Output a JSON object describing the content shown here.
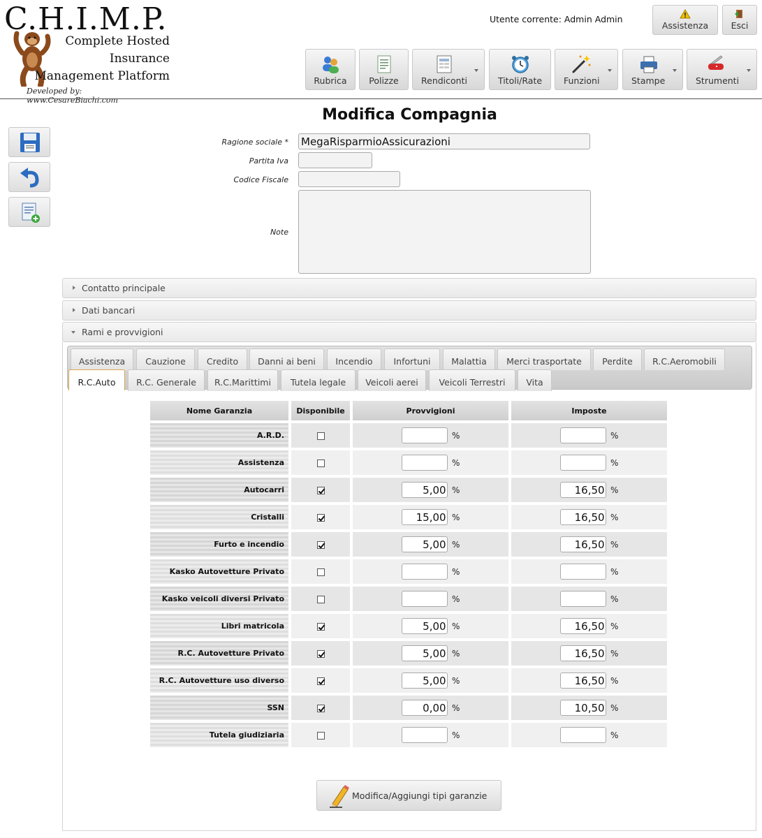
{
  "logo": {
    "title": "C.H.I.M.P.",
    "line1": "Complete Hosted",
    "line2": "Insurance",
    "line3": "Management Platform",
    "developer": "Developed by: www.CesareBiachi.com"
  },
  "header": {
    "user": "Utente corrente: Admin Admin",
    "assist_label": "Assistenza",
    "exit_label": "Esci"
  },
  "toolbar": {
    "items": [
      {
        "label": "Rubrica",
        "icon": "contacts-icon"
      },
      {
        "label": "Polizze",
        "icon": "document-icon"
      },
      {
        "label": "Rendiconti",
        "icon": "report-icon"
      },
      {
        "label": "Titoli/Rate",
        "icon": "alarm-clock-icon"
      },
      {
        "label": "Funzioni",
        "icon": "magic-wand-icon"
      },
      {
        "label": "Stampe",
        "icon": "printer-icon"
      },
      {
        "label": "Strumenti",
        "icon": "swiss-knife-icon"
      }
    ]
  },
  "form": {
    "title": "Modifica Compagnia",
    "ragione_label": "Ragione sociale *",
    "ragione_value": "MegaRisparmioAssicurazioni",
    "piva_label": "Partita Iva",
    "piva_value": "",
    "cf_label": "Codice Fiscale",
    "cf_value": "",
    "note_label": "Note",
    "note_value": ""
  },
  "accordion": {
    "contatto": "Contatto principale",
    "banca": "Dati bancari",
    "rami": "Rami e provvigioni"
  },
  "tabs": {
    "row1": [
      "Assistenza",
      "Cauzione",
      "Credito",
      "Danni ai beni",
      "Incendio",
      "Infortuni",
      "Malattia",
      "Merci trasportate",
      "Perdite",
      "R.C.Aeromobili"
    ],
    "row2": [
      "R.C.Auto",
      "R.C. Generale",
      "R.C.Marittimi",
      "Tutela legale",
      "Veicoli aerei",
      "Veicoli Terrestri",
      "Vita"
    ],
    "active": "R.C.Auto"
  },
  "table": {
    "headers": [
      "Nome Garanzia",
      "Disponibile",
      "Provvigioni",
      "Imposte"
    ],
    "percent": "%",
    "rows": [
      {
        "name": "A.R.D.",
        "available": false,
        "provvigioni": "",
        "imposte": ""
      },
      {
        "name": "Assistenza",
        "available": false,
        "provvigioni": "",
        "imposte": ""
      },
      {
        "name": "Autocarri",
        "available": true,
        "provvigioni": "5,00",
        "imposte": "16,50"
      },
      {
        "name": "Cristalli",
        "available": true,
        "provvigioni": "15,00",
        "imposte": "16,50"
      },
      {
        "name": "Furto e incendio",
        "available": true,
        "provvigioni": "5,00",
        "imposte": "16,50"
      },
      {
        "name": "Kasko Autovetture Privato",
        "available": false,
        "provvigioni": "",
        "imposte": ""
      },
      {
        "name": "Kasko veicoli diversi Privato",
        "available": false,
        "provvigioni": "",
        "imposte": ""
      },
      {
        "name": "Libri matricola",
        "available": true,
        "provvigioni": "5,00",
        "imposte": "16,50"
      },
      {
        "name": "R.C. Autovetture Privato",
        "available": true,
        "provvigioni": "5,00",
        "imposte": "16,50"
      },
      {
        "name": "R.C. Autovetture uso diverso",
        "available": true,
        "provvigioni": "5,00",
        "imposte": "16,50"
      },
      {
        "name": "SSN",
        "available": true,
        "provvigioni": "0,00",
        "imposte": "10,50"
      },
      {
        "name": "Tutela giudiziaria",
        "available": false,
        "provvigioni": "",
        "imposte": ""
      }
    ]
  },
  "edit_button": "Modifica/Aggiungi tipi garanzie",
  "side": {
    "save_icon": "save-icon",
    "undo_icon": "undo-icon",
    "add_icon": "add-document-icon"
  }
}
